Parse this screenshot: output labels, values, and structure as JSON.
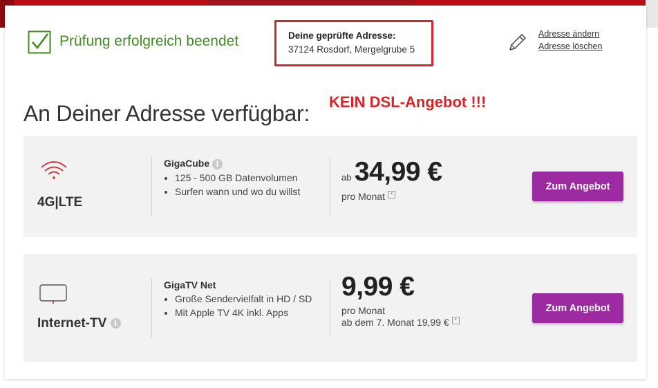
{
  "status": {
    "check_text": "Prüfung erfolgreich beendet",
    "color": "#428a22"
  },
  "address": {
    "title": "Deine geprüfte Adresse:",
    "value": "37124 Rosdorf, Mergelgrube 5",
    "change_link": "Adresse ändern",
    "delete_link": "Adresse löschen",
    "highlight_color": "#d4262a"
  },
  "heading": "An Deiner Adresse verfügbar:",
  "annotation": "KEIN DSL-Angebot !!!",
  "offers": [
    {
      "type_label": "4G|LTE",
      "icon": "wifi-icon",
      "product_name": "GigaCube",
      "features": [
        "125 - 500 GB Datenvolumen",
        "Surfen wann und wo du willst"
      ],
      "price_prefix": "ab",
      "price": "34,99 €",
      "price_period": "pro Monat",
      "price_note": "",
      "button": "Zum Angebot"
    },
    {
      "type_label": "Internet-TV",
      "icon": "tv-icon",
      "product_name": "GigaTV Net",
      "features": [
        "Große Sendervielfalt in HD / SD",
        "Mit Apple TV 4K inkl. Apps"
      ],
      "price_prefix": "",
      "price": "9,99 €",
      "price_period": "pro Monat",
      "price_note": "ab dem 7. Monat 19,99 €",
      "button": "Zum Angebot"
    }
  ],
  "colors": {
    "brand_red": "#b90e16",
    "button_purple": "#9c2aa0",
    "panel_gray": "#f2f2f2"
  }
}
